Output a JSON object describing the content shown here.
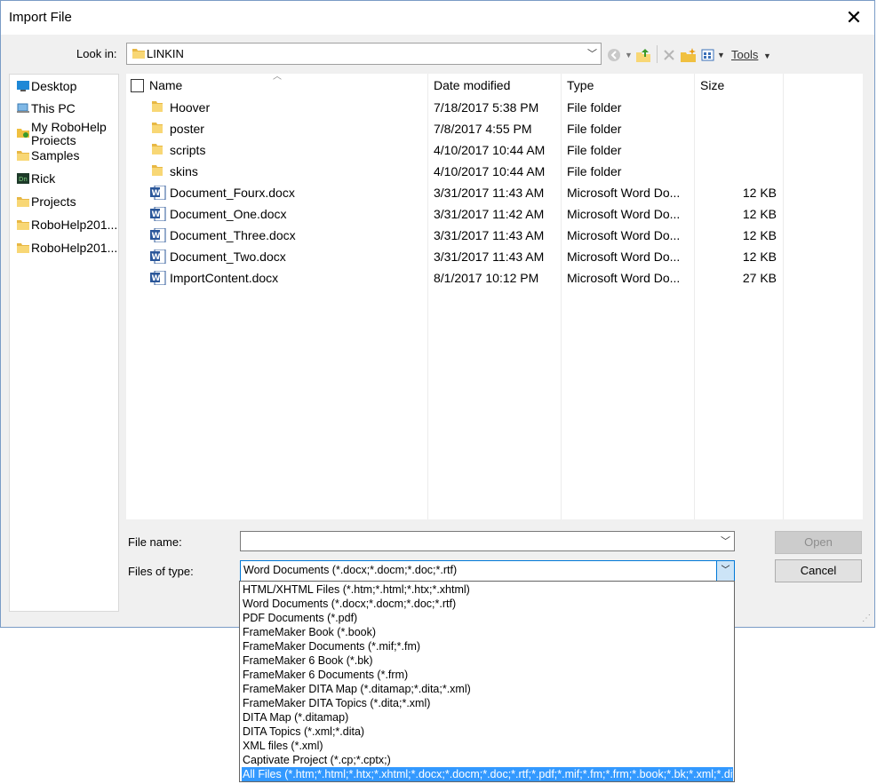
{
  "dialog": {
    "title": "Import File",
    "close_label": "✕"
  },
  "lookin": {
    "label": "Look in:",
    "value": "LINKIN"
  },
  "toolbar": {
    "tools_label": "Tools"
  },
  "sidebar": {
    "items": [
      {
        "label": "Desktop",
        "icon": "desktop-icon"
      },
      {
        "label": "This PC",
        "icon": "computer-icon"
      },
      {
        "label": "My RoboHelp Projects",
        "icon": "robohelp-folder-icon"
      },
      {
        "label": "Samples",
        "icon": "folder-icon"
      },
      {
        "label": "Rick",
        "icon": "user-app-icon"
      },
      {
        "label": "Projects",
        "icon": "folder-icon"
      },
      {
        "label": "RoboHelp201...",
        "icon": "folder-icon"
      },
      {
        "label": "RoboHelp201...",
        "icon": "folder-icon"
      }
    ]
  },
  "columns": {
    "name": "Name",
    "date": "Date modified",
    "type": "Type",
    "size": "Size"
  },
  "files": [
    {
      "name": "Hoover",
      "date": "7/18/2017 5:38 PM",
      "type": "File folder",
      "size": "",
      "kind": "folder"
    },
    {
      "name": "poster",
      "date": "7/8/2017 4:55 PM",
      "type": "File folder",
      "size": "",
      "kind": "folder"
    },
    {
      "name": "scripts",
      "date": "4/10/2017 10:44 AM",
      "type": "File folder",
      "size": "",
      "kind": "folder"
    },
    {
      "name": "skins",
      "date": "4/10/2017 10:44 AM",
      "type": "File folder",
      "size": "",
      "kind": "folder"
    },
    {
      "name": "Document_Fourx.docx",
      "date": "3/31/2017 11:43 AM",
      "type": "Microsoft Word Do...",
      "size": "12 KB",
      "kind": "word"
    },
    {
      "name": "Document_One.docx",
      "date": "3/31/2017 11:42 AM",
      "type": "Microsoft Word Do...",
      "size": "12 KB",
      "kind": "word"
    },
    {
      "name": "Document_Three.docx",
      "date": "3/31/2017 11:43 AM",
      "type": "Microsoft Word Do...",
      "size": "12 KB",
      "kind": "word"
    },
    {
      "name": "Document_Two.docx",
      "date": "3/31/2017 11:43 AM",
      "type": "Microsoft Word Do...",
      "size": "12 KB",
      "kind": "word"
    },
    {
      "name": "ImportContent.docx",
      "date": "8/1/2017 10:12 PM",
      "type": "Microsoft Word Do...",
      "size": "27 KB",
      "kind": "word"
    }
  ],
  "filename": {
    "label": "File name:",
    "value": ""
  },
  "filetype": {
    "label": "Files of type:",
    "value": "Word Documents (*.docx;*.docm;*.doc;*.rtf)",
    "options": [
      "HTML/XHTML Files (*.htm;*.html;*.htx;*.xhtml)",
      "Word Documents (*.docx;*.docm;*.doc;*.rtf)",
      "PDF Documents (*.pdf)",
      "FrameMaker Book (*.book)",
      "FrameMaker Documents (*.mif;*.fm)",
      "FrameMaker 6 Book (*.bk)",
      "FrameMaker 6 Documents (*.frm)",
      "FrameMaker DITA Map (*.ditamap;*.dita;*.xml)",
      "FrameMaker DITA Topics (*.dita;*.xml)",
      "DITA Map (*.ditamap)",
      "DITA Topics (*.xml;*.dita)",
      "XML files (*.xml)",
      "Captivate Project (*.cp;*.cptx;)",
      "All Files (*.htm;*.html;*.htx;*.xhtml;*.docx;*.docm;*.doc;*.rtf;*.pdf;*.mif;*.fm;*.frm;*.book;*.bk;*.xml;*.dita;*.ditamap)"
    ],
    "selected_option": "All Files (*.htm;*.html;*.htx;*.xhtml;*.docx;*.docm;*.doc;*.rtf;*.pdf;*.mif;*.fm;*.frm;*.book;*.bk;*.xml;*.dita;*.ditamap)"
  },
  "buttons": {
    "open": "Open",
    "cancel": "Cancel"
  }
}
